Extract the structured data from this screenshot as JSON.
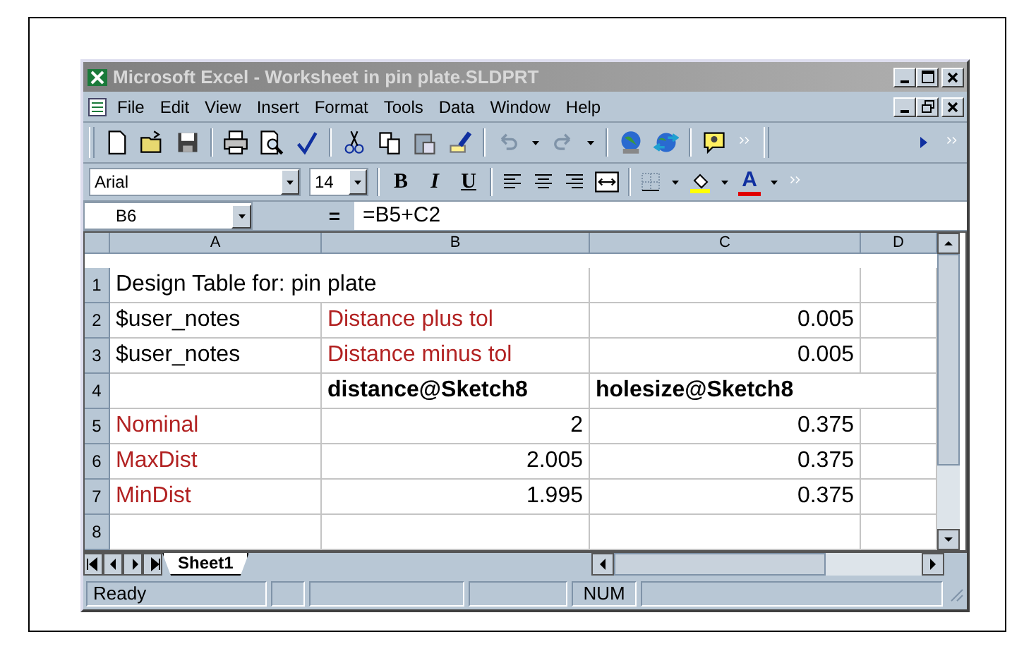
{
  "window": {
    "title": "Microsoft Excel - Worksheet in pin plate.SLDPRT"
  },
  "menu": [
    "File",
    "Edit",
    "View",
    "Insert",
    "Format",
    "Tools",
    "Data",
    "Window",
    "Help"
  ],
  "formatting": {
    "font": "Arial",
    "size": "14",
    "bold": "B",
    "italic": "I",
    "underline": "U",
    "font_color": "A"
  },
  "formula_bar": {
    "name_box": "B6",
    "equals": "=",
    "formula": "=B5+C2"
  },
  "columns": [
    "A",
    "B",
    "C",
    "D"
  ],
  "rows": [
    {
      "header": "1",
      "cells": [
        {
          "text": "Design Table for: pin plate",
          "kind": "text",
          "color": "#000000",
          "bold": false
        },
        {
          "kind": "empty"
        },
        {
          "kind": "empty"
        },
        {
          "kind": "empty"
        }
      ]
    },
    {
      "header": "2",
      "cells": [
        {
          "text": "$user_notes",
          "kind": "text",
          "color": "#000000",
          "bold": false
        },
        {
          "text": "Distance plus tol",
          "kind": "text",
          "color": "#b22222",
          "bold": false
        },
        {
          "text": "0.005",
          "kind": "number",
          "color": "#000000",
          "bold": false
        },
        {
          "kind": "empty"
        }
      ]
    },
    {
      "header": "3",
      "cells": [
        {
          "text": "$user_notes",
          "kind": "text",
          "color": "#000000",
          "bold": false
        },
        {
          "text": "Distance minus tol",
          "kind": "text",
          "color": "#b22222",
          "bold": false
        },
        {
          "text": "0.005",
          "kind": "number",
          "color": "#000000",
          "bold": false
        },
        {
          "kind": "empty"
        }
      ]
    },
    {
      "header": "4",
      "cells": [
        {
          "kind": "empty"
        },
        {
          "text": "distance@Sketch8",
          "kind": "text",
          "color": "#000000",
          "bold": true
        },
        {
          "text": "holesize@Sketch8",
          "kind": "text",
          "color": "#000000",
          "bold": true
        },
        {
          "kind": "empty"
        }
      ]
    },
    {
      "header": "5",
      "cells": [
        {
          "text": "Nominal",
          "kind": "text",
          "color": "#b22222",
          "bold": false
        },
        {
          "text": "2",
          "kind": "number",
          "color": "#000000",
          "bold": false
        },
        {
          "text": "0.375",
          "kind": "number",
          "color": "#000000",
          "bold": false
        },
        {
          "kind": "empty"
        }
      ]
    },
    {
      "header": "6",
      "cells": [
        {
          "text": "MaxDist",
          "kind": "text",
          "color": "#b22222",
          "bold": false
        },
        {
          "text": "2.005",
          "kind": "number",
          "color": "#000000",
          "bold": false
        },
        {
          "text": "0.375",
          "kind": "number",
          "color": "#000000",
          "bold": false
        },
        {
          "kind": "empty"
        }
      ]
    },
    {
      "header": "7",
      "cells": [
        {
          "text": "MinDist",
          "kind": "text",
          "color": "#b22222",
          "bold": false
        },
        {
          "text": "1.995",
          "kind": "number",
          "color": "#000000",
          "bold": false
        },
        {
          "text": "0.375",
          "kind": "number",
          "color": "#000000",
          "bold": false
        },
        {
          "kind": "empty"
        }
      ]
    },
    {
      "header": "8",
      "cells": [
        {
          "kind": "empty"
        },
        {
          "kind": "empty"
        },
        {
          "kind": "empty"
        },
        {
          "kind": "empty"
        }
      ]
    }
  ],
  "sheet_tabs": [
    {
      "label": "Sheet1",
      "selected": true
    }
  ],
  "status_bar": {
    "text": "Ready",
    "indicators": [
      "NUM"
    ]
  }
}
